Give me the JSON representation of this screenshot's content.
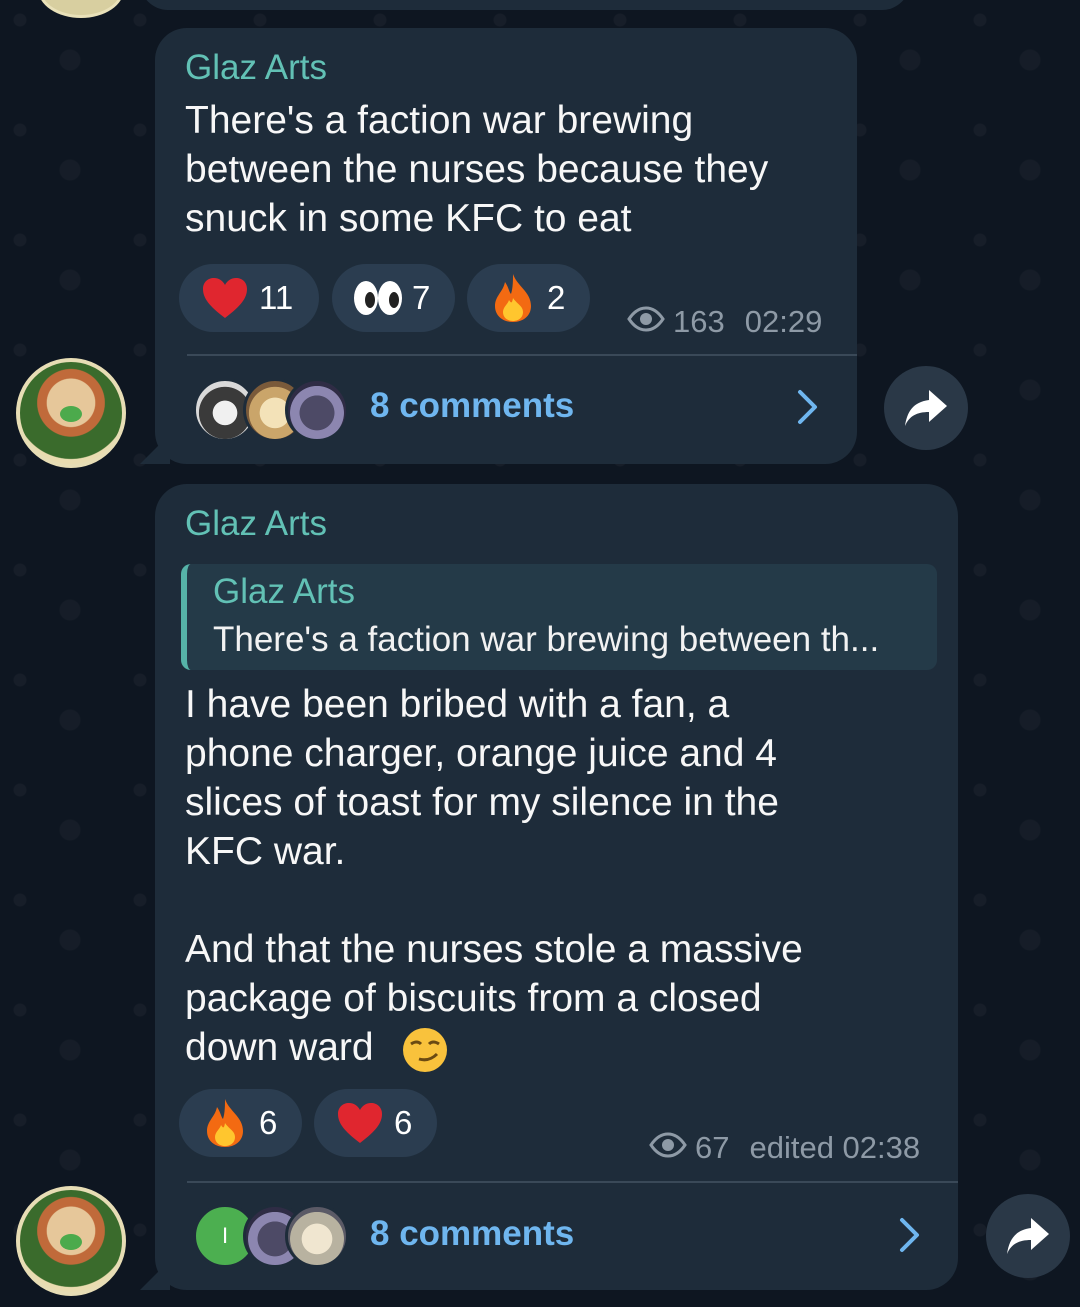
{
  "messages": [
    {
      "sender": "Glaz Arts",
      "text": "There's a faction war brewing\nbetween the nurses because they\nsnuck in some KFC to eat",
      "reactions": [
        {
          "emoji": "heart-icon",
          "count": "11"
        },
        {
          "emoji": "eyes-icon",
          "count": "7"
        },
        {
          "emoji": "fire-icon",
          "count": "2"
        }
      ],
      "views": "163",
      "time": "02:29",
      "comments_label": "8 comments"
    },
    {
      "sender": "Glaz Arts",
      "reply": {
        "sender": "Glaz Arts",
        "text": "There's a faction war brewing between th..."
      },
      "text": "I have been bribed with a fan, a\nphone charger, orange juice and 4\nslices of toast for my silence in the\nKFC war.\n\nAnd that the nurses stole a massive\npackage of biscuits from a closed\ndown ward",
      "text_emoji": "smirk-emoji-icon",
      "reactions": [
        {
          "emoji": "fire-icon",
          "count": "6"
        },
        {
          "emoji": "heart-icon",
          "count": "6"
        }
      ],
      "views": "67",
      "time": "edited 02:38",
      "comments_label": "8 comments",
      "commenter_initial": "I"
    }
  ],
  "colors": {
    "background": "#0e1621",
    "bubble": "#1e2c3a",
    "sender": "#62c1b5",
    "link": "#6fb6ef",
    "meta": "#8e9aa6"
  }
}
